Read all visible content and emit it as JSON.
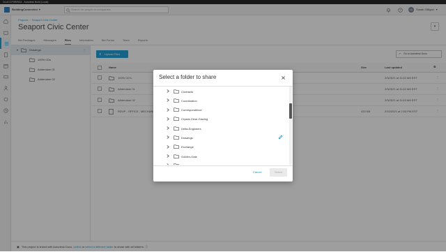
{
  "window": {
    "title": "24-ACCPSBRID4 - Autodesk Build (Local)"
  },
  "topbar": {
    "app_name": "BuildingConnected",
    "search_placeholder": "Search for people or companies",
    "user_name": "Susan Gilligan",
    "user_initials": "SG"
  },
  "main": {
    "breadcrumb": {
      "root": "Projects",
      "current": "Seaport Civic Center"
    },
    "title": "Seaport Civic Center",
    "tabs": [
      {
        "label": "Bid Packages",
        "active": false
      },
      {
        "label": "Messages",
        "active": false
      },
      {
        "label": "Files",
        "active": true
      },
      {
        "label": "Information",
        "active": false
      },
      {
        "label": "Bid Forms",
        "active": false
      },
      {
        "label": "Team",
        "active": false
      },
      {
        "label": "Reports",
        "active": false
      }
    ],
    "upload_label": "Upload Files",
    "goto_label": "Go to Autodesk Docs"
  },
  "tree": {
    "root": "Drawings",
    "children": [
      "100% CDs",
      "Addendum 01",
      "Addendum 02"
    ]
  },
  "table": {
    "headers": {
      "name": "Name",
      "size": "Size",
      "updated": "Last updated"
    },
    "rows": [
      {
        "name": "100% CD's",
        "size": "",
        "updated": "2/3/2021 at 11:42 AM EST"
      },
      {
        "name": "Addendum 01",
        "size": "",
        "updated": "2/3/2021 at 11:42 AM EST"
      },
      {
        "name": "Addendum 02",
        "size": "",
        "updated": "2/3/2021 at 11:43 AM EST"
      },
      {
        "name": "RDUP - OFFICE - MECHANI",
        "size": "433 KB",
        "updated": "2/10/2021 at 2:53 PM EST"
      }
    ]
  },
  "footer": {
    "text": "This project is linked with Autodesk Docs.",
    "unlink": "Unlink",
    "or": "or",
    "select": "select a different folder",
    "tail": "to share with all bidders."
  },
  "modal": {
    "title": "Select a folder to share",
    "folders": [
      {
        "label": "Contracts",
        "selected": false
      },
      {
        "label": "Coordination",
        "selected": false
      },
      {
        "label": "Correspondence",
        "selected": false
      },
      {
        "label": "Crystal-Clear-Glazing",
        "selected": false
      },
      {
        "label": "Delta-Engineers",
        "selected": false
      },
      {
        "label": "Drawings",
        "selected": true
      },
      {
        "label": "Exchange",
        "selected": false
      },
      {
        "label": "Golden-Gate",
        "selected": false
      },
      {
        "label": "",
        "selected": false
      }
    ],
    "cancel_label": "Cancel",
    "select_label": "Select"
  },
  "colors": {
    "accent": "#0696d7",
    "overlay": "rgba(40,40,40,0.45)"
  }
}
